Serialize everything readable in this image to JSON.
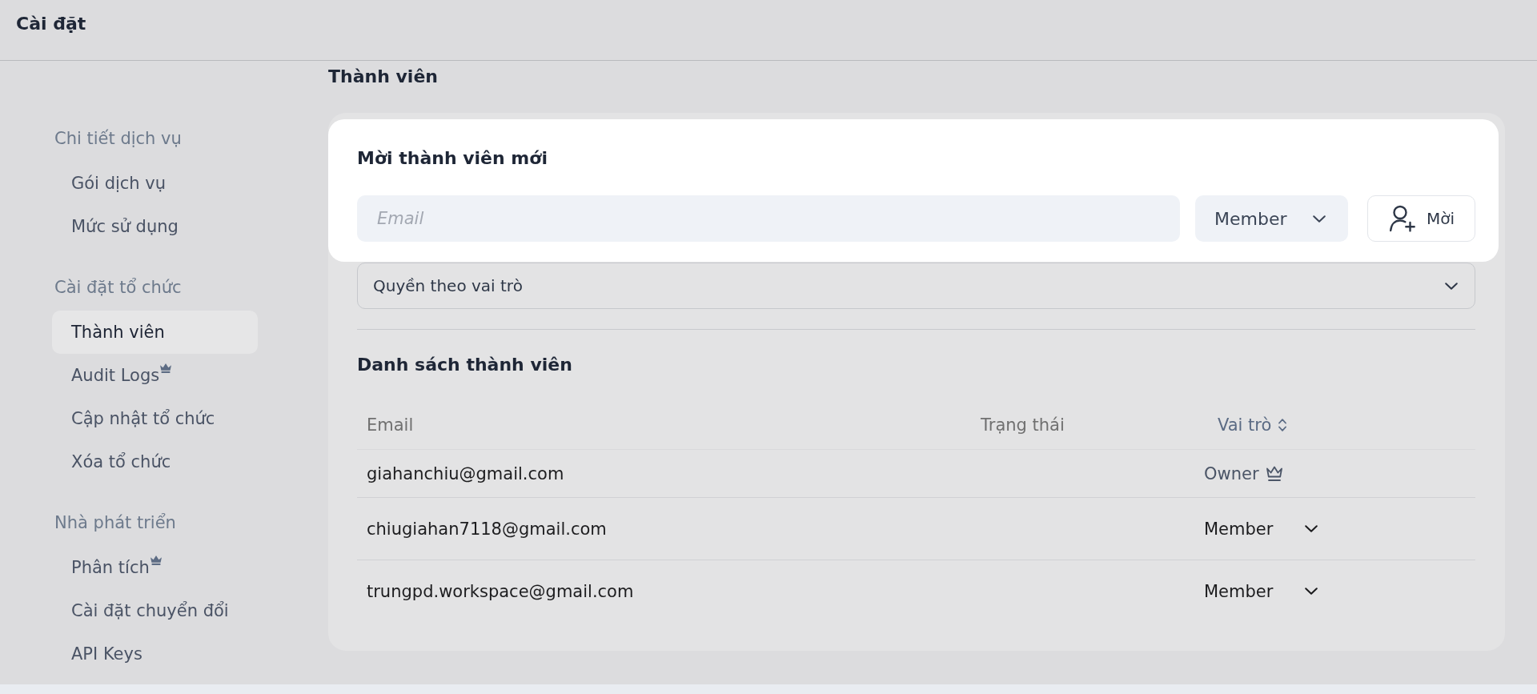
{
  "header": {
    "title": "Cài đặt"
  },
  "sidebar": {
    "sections": [
      {
        "label": "Chi tiết dịch vụ",
        "items": [
          {
            "label": "Gói dịch vụ",
            "selected": false,
            "premium": false
          },
          {
            "label": "Mức sử dụng",
            "selected": false,
            "premium": false
          }
        ]
      },
      {
        "label": "Cài đặt tổ chức",
        "items": [
          {
            "label": "Thành viên",
            "selected": true,
            "premium": false
          },
          {
            "label": "Audit Logs",
            "selected": false,
            "premium": true
          },
          {
            "label": "Cập nhật tổ chức",
            "selected": false,
            "premium": false
          },
          {
            "label": "Xóa tổ chức",
            "selected": false,
            "premium": false
          }
        ]
      },
      {
        "label": "Nhà phát triển",
        "items": [
          {
            "label": "Phân tích",
            "selected": false,
            "premium": true
          },
          {
            "label": "Cài đặt chuyển đổi",
            "selected": false,
            "premium": false
          },
          {
            "label": "API Keys",
            "selected": false,
            "premium": false
          }
        ]
      }
    ]
  },
  "page": {
    "title": "Thành viên"
  },
  "invite": {
    "title": "Mời thành viên mới",
    "email": {
      "placeholder": "Email"
    },
    "role": {
      "value": "Member"
    },
    "button": {
      "label": "Mời"
    }
  },
  "permissions": {
    "label": "Quyền theo vai trò",
    "expanded": false
  },
  "members": {
    "title": "Danh sách thành viên",
    "columns": [
      {
        "label": "Email",
        "sortable": false
      },
      {
        "label": "Trạng thái",
        "sortable": false
      },
      {
        "label": "Vai trò",
        "sortable": true
      }
    ],
    "rows": [
      {
        "email": "giahanchiu@gmail.com",
        "kind": "owner",
        "role": "Owner"
      },
      {
        "email": "chiugiahan7118@gmail.com",
        "kind": "select",
        "role": "Member"
      },
      {
        "email": "trungpd.workspace@gmail.com",
        "kind": "select",
        "role": "Member"
      }
    ]
  }
}
